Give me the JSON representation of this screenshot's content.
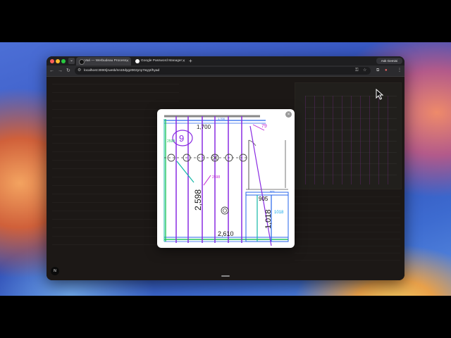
{
  "browser": {
    "tabs": [
      {
        "title": "Vari — Werbudeau Process",
        "active": true
      },
      {
        "title": "Google Password Manager",
        "active": false
      }
    ],
    "new_tab": "+",
    "tab_menu": "⌄",
    "gemini_label": "Ask Gemini",
    "url": "localhost:3000/jruesb/nn10dyg2002yny7wyyt/hyad"
  },
  "content": {
    "badge": "N"
  },
  "modal": {
    "close": "×",
    "drawing": {
      "dim_top": "1,700",
      "dim_topright": "79",
      "circle_number": "9",
      "dim_vertical_main": "2,598",
      "dim_leader": "2598",
      "dim_left_green": "2598",
      "dim_905": "905",
      "dim_1018_vertical": "1,018",
      "dim_1018_blue": "1018",
      "dim_bottom": "2,610",
      "dim_small_top": "1,700",
      "small_right": "nes"
    }
  },
  "colors": {
    "purple": "#8a2be2",
    "green": "#22c55e",
    "blue": "#2563eb",
    "teal": "#14b8a6",
    "magenta": "#c026d3",
    "cyan": "#0ea5e9"
  }
}
